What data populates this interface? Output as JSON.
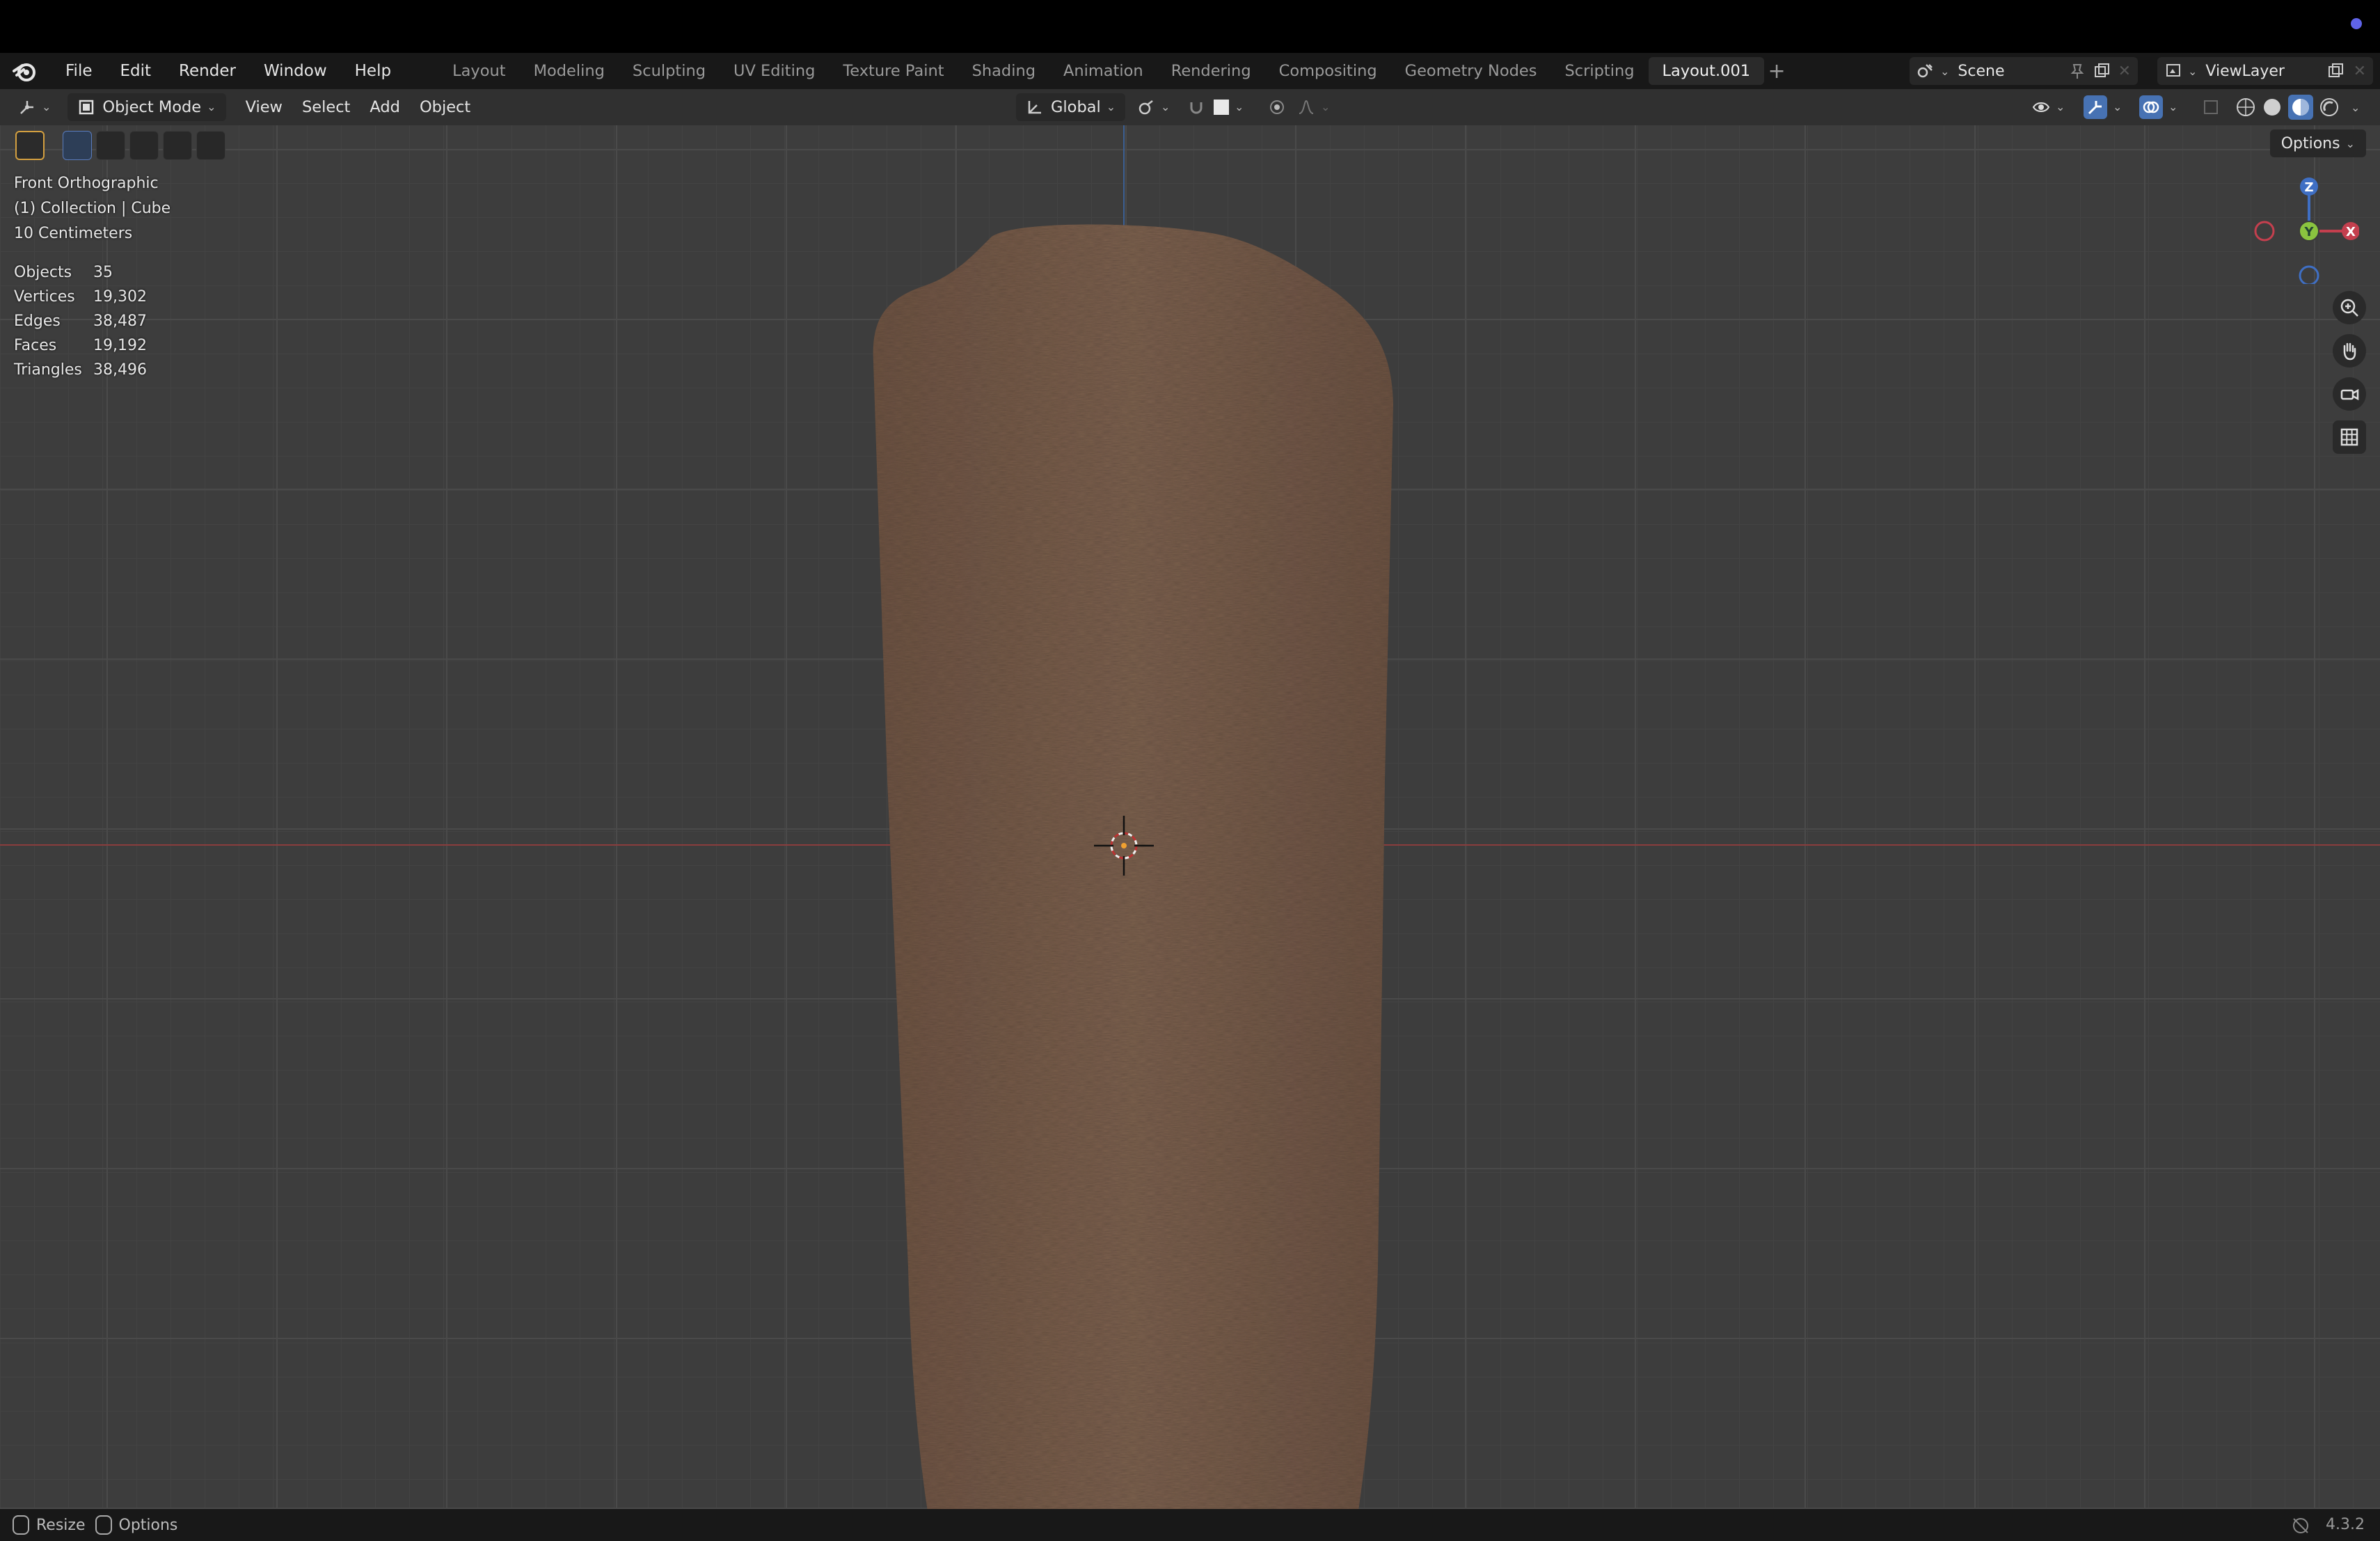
{
  "menu": {
    "items": [
      {
        "label": "File"
      },
      {
        "label": "Edit"
      },
      {
        "label": "Render"
      },
      {
        "label": "Window"
      },
      {
        "label": "Help"
      }
    ]
  },
  "workspaces": {
    "tabs": [
      {
        "label": "Layout",
        "active": false
      },
      {
        "label": "Modeling",
        "active": false
      },
      {
        "label": "Sculpting",
        "active": false
      },
      {
        "label": "UV Editing",
        "active": false
      },
      {
        "label": "Texture Paint",
        "active": false
      },
      {
        "label": "Shading",
        "active": false
      },
      {
        "label": "Animation",
        "active": false
      },
      {
        "label": "Rendering",
        "active": false
      },
      {
        "label": "Compositing",
        "active": false
      },
      {
        "label": "Geometry Nodes",
        "active": false
      },
      {
        "label": "Scripting",
        "active": false
      },
      {
        "label": "Layout.001",
        "active": true
      }
    ]
  },
  "scene": {
    "name": "Scene"
  },
  "view_layer": {
    "name": "ViewLayer"
  },
  "viewport_header": {
    "mode": "Object Mode",
    "view": "View",
    "select": "Select",
    "add": "Add",
    "object": "Object",
    "orientation": "Global"
  },
  "overlay": {
    "view_name": "Front Orthographic",
    "collection": "(1) Collection | Cube",
    "scale": "10 Centimeters",
    "stats": [
      {
        "key": "Objects",
        "value": "35"
      },
      {
        "key": "Vertices",
        "value": "19,302"
      },
      {
        "key": "Edges",
        "value": "38,487"
      },
      {
        "key": "Faces",
        "value": "19,192"
      },
      {
        "key": "Triangles",
        "value": "38,496"
      }
    ]
  },
  "options_label": "Options",
  "gizmo": {
    "z": "Z",
    "y": "Y",
    "x": "X"
  },
  "statusbar": {
    "resize": "Resize",
    "options": "Options",
    "version": "4.3.2"
  },
  "colors": {
    "fur": "#7a5e4a",
    "axis_x": "#8a3d3d",
    "axis_z": "#3c5f93",
    "accent": "#4772b3"
  }
}
